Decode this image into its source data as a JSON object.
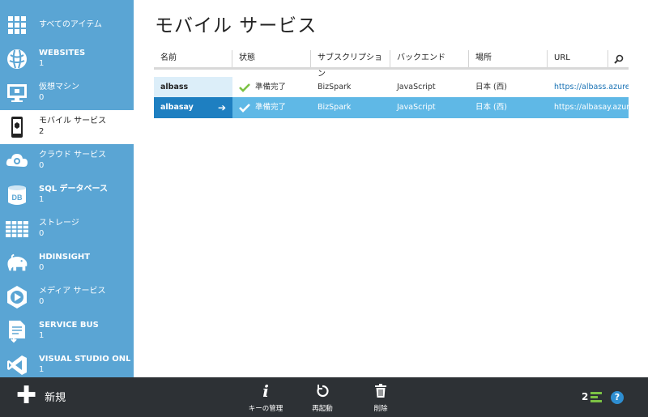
{
  "sidebar": {
    "items": [
      {
        "label": "すべてのアイテム",
        "count": "",
        "icon": "grid-icon"
      },
      {
        "label": "WEBSITES",
        "count": "1",
        "icon": "globe-icon"
      },
      {
        "label": "仮想マシン",
        "count": "0",
        "icon": "monitor-icon"
      },
      {
        "label": "モバイル サービス",
        "count": "2",
        "icon": "mobile-icon"
      },
      {
        "label": "クラウド サービス",
        "count": "0",
        "icon": "cloud-gear-icon"
      },
      {
        "label": "SQL データベース",
        "count": "1",
        "icon": "database-icon"
      },
      {
        "label": "ストレージ",
        "count": "0",
        "icon": "table-icon"
      },
      {
        "label": "HDINSIGHT",
        "count": "0",
        "icon": "elephant-icon"
      },
      {
        "label": "メディア サービス",
        "count": "0",
        "icon": "play-icon"
      },
      {
        "label": "SERVICE BUS",
        "count": "1",
        "icon": "document-arrow-icon"
      },
      {
        "label": "VISUAL STUDIO ONLINE",
        "count": "1",
        "icon": "visual-studio-icon"
      }
    ]
  },
  "main": {
    "title": "モバイル サービス",
    "columns": [
      "名前",
      "状態",
      "サブスクリプション",
      "バックエンド",
      "場所",
      "URL"
    ],
    "rows": [
      {
        "name": "albass",
        "status": "準備完了",
        "subscription": "BizSpark",
        "backend": "JavaScript",
        "location": "日本 (西)",
        "url": "https://albass.azure..."
      },
      {
        "name": "albasay",
        "status": "準備完了",
        "subscription": "BizSpark",
        "backend": "JavaScript",
        "location": "日本 (西)",
        "url": "https://albasay.azur..."
      }
    ]
  },
  "bottombar": {
    "new_label": "新規",
    "commands": [
      {
        "label": "キーの管理",
        "icon": "info-icon"
      },
      {
        "label": "再起動",
        "icon": "restart-icon"
      },
      {
        "label": "削除",
        "icon": "trash-icon"
      }
    ],
    "notification_count": "2",
    "help_label": "?"
  },
  "colors": {
    "sidebar": "#5aa5d4",
    "selected_row": "#5fb8e6",
    "selected_name": "#1e7fc1",
    "bottombar": "#2d3135",
    "status_check": "#7cc244"
  }
}
